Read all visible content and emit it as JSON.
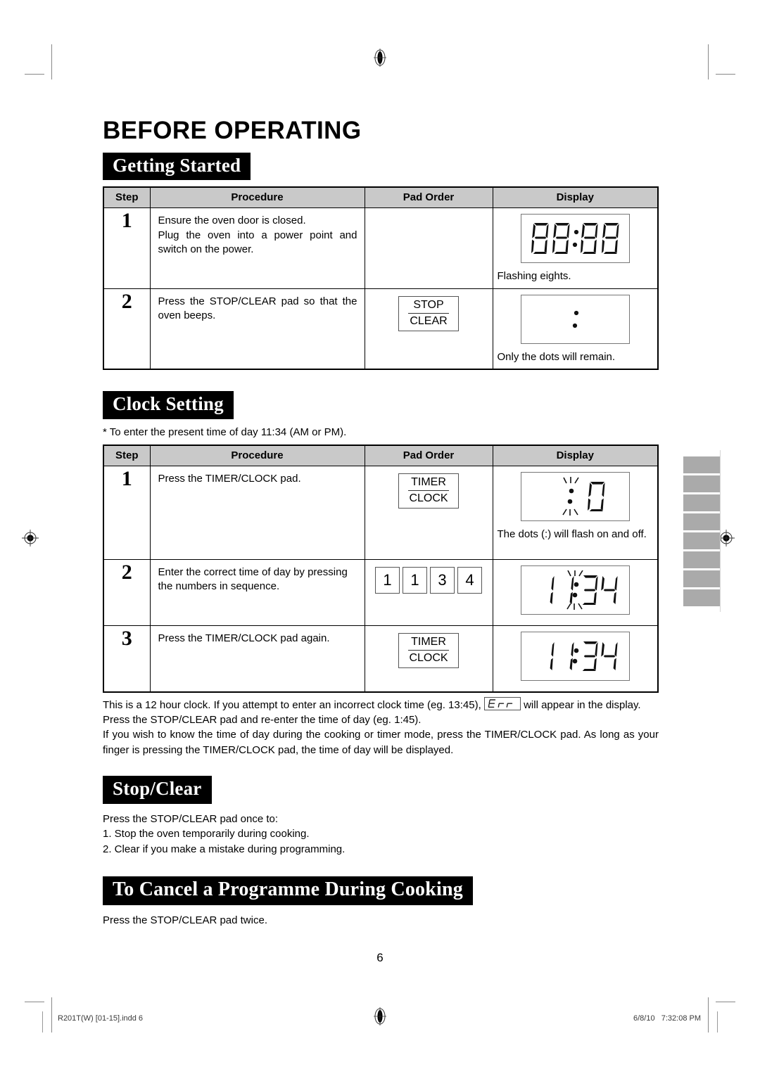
{
  "document": {
    "main_title": "BEFORE OPERATING",
    "page_number": "6"
  },
  "sections": {
    "getting_started": {
      "heading": "Getting Started",
      "table": {
        "headers": [
          "Step",
          "Procedure",
          "Pad Order",
          "Display"
        ],
        "rows": [
          {
            "step": "1",
            "procedure_lines": [
              "Ensure the oven door is closed.",
              "Plug the oven into a power point and switch on the power."
            ],
            "pad": null,
            "display_value": "88:88",
            "display_note": "Flashing eights."
          },
          {
            "step": "2",
            "procedure_lines": [
              "Press the STOP/CLEAR pad so that the oven beeps."
            ],
            "pad": {
              "top": "STOP",
              "bottom": "CLEAR"
            },
            "display_value": "dots",
            "display_note": "Only the dots will remain."
          }
        ]
      }
    },
    "clock_setting": {
      "heading": "Clock Setting",
      "note": "*   To enter the present time of day 11:34 (AM or PM).",
      "table": {
        "headers": [
          "Step",
          "Procedure",
          "Pad Order",
          "Display"
        ],
        "rows": [
          {
            "step": "1",
            "procedure_lines": [
              "Press the TIMER/CLOCK pad."
            ],
            "pad": {
              "top": "TIMER",
              "bottom": "CLOCK"
            },
            "display_value": ": 0",
            "display_note": "The dots (:) will flash on and off."
          },
          {
            "step": "2",
            "procedure_lines": [
              "Enter the correct time of day by pressing the numbers in sequence."
            ],
            "numpads": [
              "1",
              "1",
              "3",
              "4"
            ],
            "display_value": "11:34",
            "display_note": ""
          },
          {
            "step": "3",
            "procedure_lines": [
              "Press the TIMER/CLOCK pad again."
            ],
            "pad": {
              "top": "TIMER",
              "bottom": "CLOCK"
            },
            "display_value": "11:34",
            "display_note": ""
          }
        ]
      },
      "paragraphs": {
        "p1_before": "This is a 12 hour clock. If you attempt to enter an incorrect clock time (eg. 13:45), ",
        "p1_err": "Err",
        "p1_after": " will appear in the display.",
        "p2": "Press the STOP/CLEAR pad and re-enter the time of day (eg. 1:45).",
        "p3": "If you wish to know the time of day during the cooking or timer mode, press the TIMER/CLOCK pad. As long as your finger is pressing the TIMER/CLOCK pad, the time of day will be displayed."
      }
    },
    "stop_clear": {
      "heading": "Stop/Clear",
      "intro": "Press the STOP/CLEAR pad once to:",
      "items": [
        "1.   Stop the oven temporarily during cooking.",
        "2.   Clear if you make a mistake during programming."
      ]
    },
    "cancel_programme": {
      "heading": "To Cancel a Programme During Cooking",
      "text": "Press the STOP/CLEAR pad twice."
    }
  },
  "footer": {
    "left": "R201T(W) [01-15].indd   6",
    "right": "6/8/10   7:32:08 PM"
  }
}
